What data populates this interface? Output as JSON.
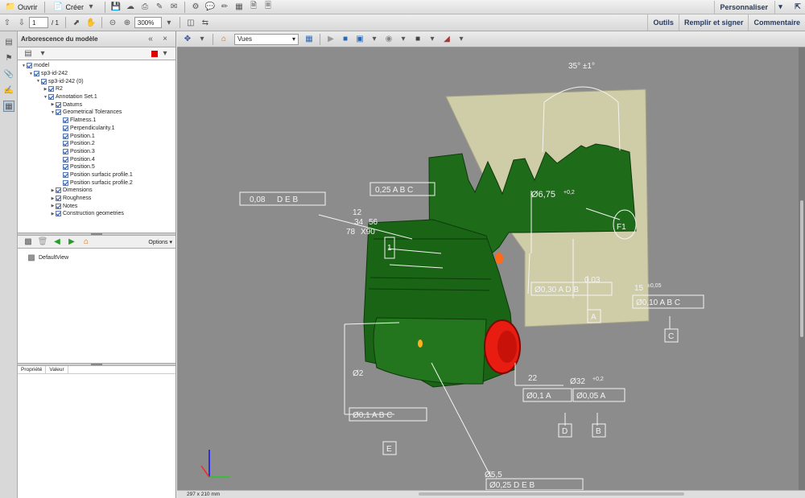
{
  "menubar": {
    "open_label": "Ouvrir",
    "create_label": "Créer",
    "customize_label": "Personnaliser"
  },
  "toolbar": {
    "page_current": "1",
    "page_total": "/ 1",
    "zoom": "300%"
  },
  "right_links": [
    "Outils",
    "Remplir et signer",
    "Commentaire"
  ],
  "panel": {
    "title": "Arborescence du modèle",
    "tree": [
      {
        "label": "model",
        "depth": 0,
        "open": true
      },
      {
        "label": "sp3-id-242",
        "depth": 1,
        "open": true
      },
      {
        "label": "sp3-id-242 (0)",
        "depth": 2,
        "open": true
      },
      {
        "label": "R2",
        "depth": 3,
        "open": false
      },
      {
        "label": "Annotation Set.1",
        "depth": 3,
        "open": true
      },
      {
        "label": "Datums",
        "depth": 4,
        "open": false
      },
      {
        "label": "Geometrical Tolerances",
        "depth": 4,
        "open": true
      },
      {
        "label": "Flatness.1",
        "depth": 5,
        "open": null
      },
      {
        "label": "Perpendicularity.1",
        "depth": 5,
        "open": null
      },
      {
        "label": "Position.1",
        "depth": 5,
        "open": null
      },
      {
        "label": "Position.2",
        "depth": 5,
        "open": null
      },
      {
        "label": "Position.3",
        "depth": 5,
        "open": null
      },
      {
        "label": "Position.4",
        "depth": 5,
        "open": null
      },
      {
        "label": "Position.5",
        "depth": 5,
        "open": null
      },
      {
        "label": "Position surfacic profile.1",
        "depth": 5,
        "open": null
      },
      {
        "label": "Position surfacic profile.2",
        "depth": 5,
        "open": null
      },
      {
        "label": "Dimensions",
        "depth": 4,
        "open": false
      },
      {
        "label": "Roughness",
        "depth": 4,
        "open": false
      },
      {
        "label": "Notes",
        "depth": 4,
        "open": false
      },
      {
        "label": "Construction geometries",
        "depth": 4,
        "open": false
      }
    ],
    "views_options_label": "Options",
    "default_view": "DefaultView",
    "prop_col": "Propriété",
    "value_col": "Valeur"
  },
  "viewer": {
    "views_select": "Vues",
    "page_size": "297 x 210 mm"
  },
  "annotations": {
    "angle": "35° ±1°",
    "fcf_top": "0,08",
    "fcf_top_refs": "D E B",
    "pos_abc": "0,25 A B C",
    "dim_12": "12",
    "dim_34": "34",
    "dim_56": "56",
    "dim_78": "78",
    "x90": "X90",
    "hole": "Ø6,75",
    "hole_tol": "+0,2",
    "flat_label": "F1",
    "datum_1": "1",
    "pos30": "Ø0,30 A D B",
    "val_003": "0,03",
    "datum_a": "A",
    "dim_15": "15",
    "dim_15_tol": "±0,05",
    "pos10abc": "Ø0,10 A B C",
    "datum_c": "C",
    "dia_2": "Ø2",
    "dim_22": "22",
    "dia_32": "Ø32",
    "dia_32_tol": "+0,2",
    "pos01a": "Ø0,1 A",
    "pos005a": "Ø0,05 A",
    "pos01ab": "Ø0,1 A B C",
    "datum_d": "D",
    "datum_b": "B",
    "datum_e": "E",
    "dia_55": "Ø5,5",
    "pos025": "Ø0,25 D E B"
  },
  "colors": {
    "part_green": "#1e6b1a",
    "plate_tan": "#cfcca8",
    "hole_red": "#e81c10",
    "accent_red": "#e00000"
  }
}
